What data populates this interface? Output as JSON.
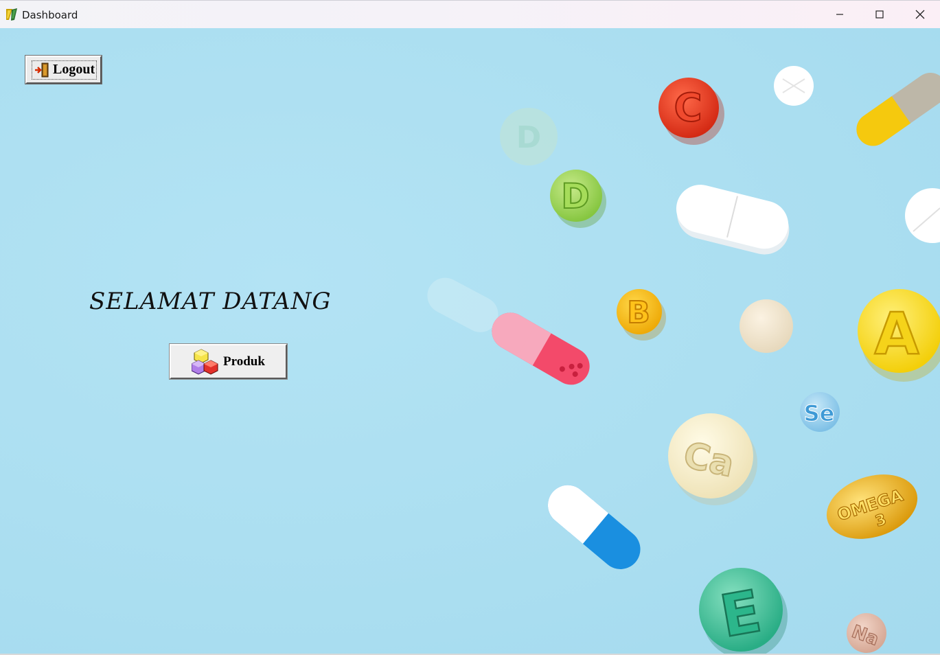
{
  "window": {
    "title": "Dashboard",
    "controls": [
      "minimize",
      "maximize",
      "close"
    ]
  },
  "toolbar": {
    "logout_label": "Logout"
  },
  "main": {
    "welcome_text": "SELAMAT DATANG",
    "produk_label": "Produk"
  },
  "background": {
    "description_icons": [
      "vitamin-c-tablet",
      "vitamin-d-tablet",
      "vitamin-b-tablet",
      "vitamin-a-tablet",
      "vitamin-e-tablet",
      "calcium-tablet",
      "selenium-tablet",
      "sodium-tablet",
      "omega-3-capsule",
      "pill-capsules"
    ],
    "pill_letters": {
      "c": "C",
      "d": "D",
      "d_faded": "D",
      "b": "B",
      "a": "A",
      "se": "Se",
      "ca": "Ca",
      "omega": "OMEGA",
      "omega_num": "3",
      "e": "E",
      "na": "Na"
    },
    "colors": {
      "sky": "#acdff1",
      "vitamin_c": "#e8321c",
      "vitamin_d": "#8fcf4a",
      "vitamin_b": "#f2b90c",
      "vitamin_a": "#f7d90f",
      "vitamin_e": "#2fb489",
      "calcium": "#f4ecc8",
      "selenium": "#5fb0de",
      "omega": "#e7a90f"
    }
  }
}
